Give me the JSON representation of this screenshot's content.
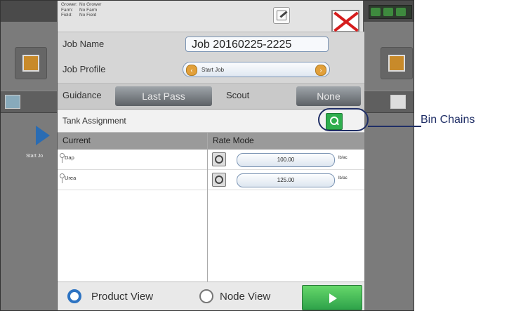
{
  "header": {
    "grower_label": "Grower:",
    "grower_value": "No Grower",
    "farm_label": "Farm:",
    "farm_value": "No Farm",
    "field_label": "Field:",
    "field_value": "No Field"
  },
  "job": {
    "name_label": "Job Name",
    "name_value": "Job 20160225-2225"
  },
  "profile": {
    "label": "Job Profile",
    "value": "Start Job"
  },
  "guidance": {
    "label": "Guidance",
    "value": "Last Pass"
  },
  "scout": {
    "label": "Scout",
    "value": "None"
  },
  "tank": {
    "label": "Tank Assignment"
  },
  "table": {
    "col_current": "Current",
    "col_rate": "Rate Mode",
    "rows": [
      {
        "product": "Dap",
        "rate": "100.00",
        "unit": "lb/ac"
      },
      {
        "product": "Urea",
        "rate": "125.00",
        "unit": "lb/ac"
      }
    ]
  },
  "footer": {
    "product_view": "Product View",
    "node_view": "Node View"
  },
  "side": {
    "start_label": "Start Jo"
  },
  "callout": {
    "text": "Bin Chains"
  },
  "colors": {
    "accent_blue": "#2d73c2",
    "go_green": "#2ea24a",
    "close_red": "#d51d1d",
    "callout_navy": "#1f2e66"
  }
}
